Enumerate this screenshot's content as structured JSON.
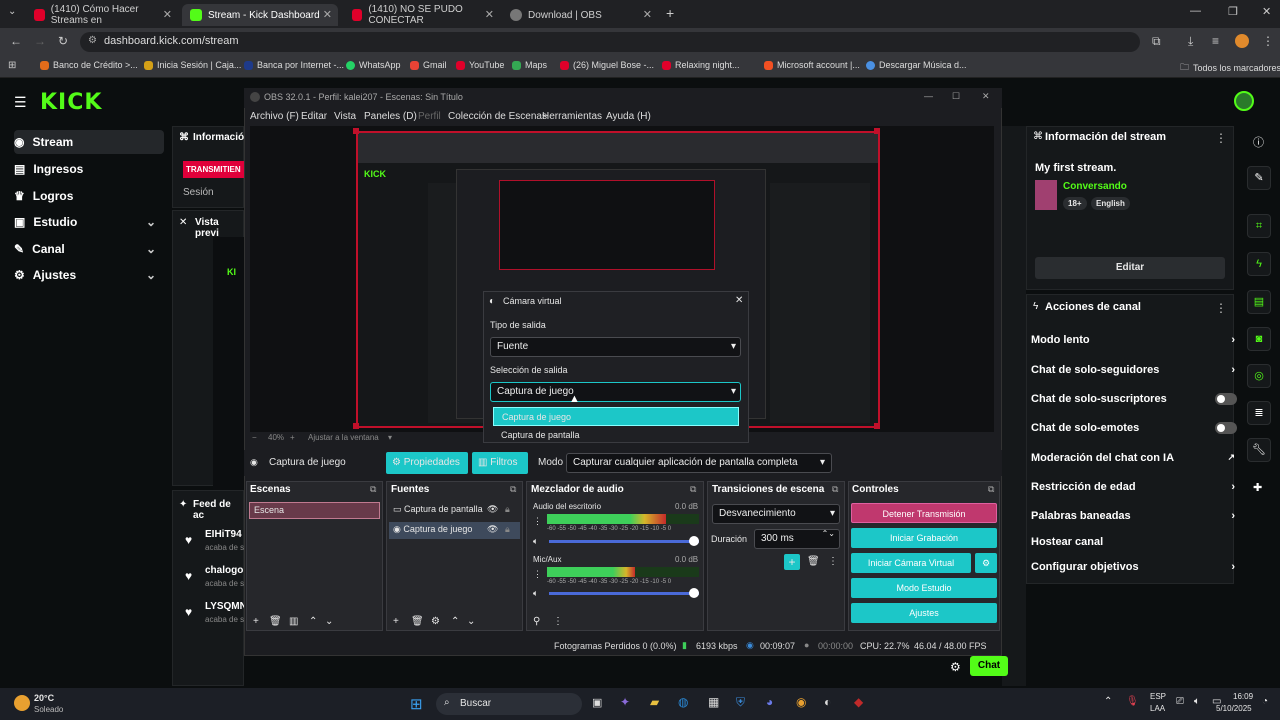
{
  "browser": {
    "tabs": [
      {
        "title": "(1410) Cómo Hacer Streams en",
        "color": "#e0002a"
      },
      {
        "title": "Stream - Kick Dashboard",
        "color": "#53fc18"
      },
      {
        "title": "(1410) NO SE PUDO CONECTAR",
        "color": "#e0002a"
      },
      {
        "title": "Download | OBS",
        "color": "#888888"
      }
    ],
    "url": "dashboard.kick.com/stream",
    "bookmarks": [
      "Banco de Crédito >...",
      "Inicia Sesión | Caja...",
      "Banca por Internet -...",
      "WhatsApp",
      "Gmail",
      "YouTube",
      "Maps",
      "(26) Miguel Bose -...",
      "Relaxing night...",
      "Microsoft account |...",
      "Descargar Música d..."
    ],
    "bookmarks_all": "Todos los marcadores"
  },
  "kick": {
    "logo": "KICK",
    "nav": [
      {
        "label": "Stream",
        "icon": "stream-icon",
        "chev": false
      },
      {
        "label": "Ingresos",
        "icon": "money-icon",
        "chev": false
      },
      {
        "label": "Logros",
        "icon": "trophy-icon",
        "chev": false
      },
      {
        "label": "Estudio",
        "icon": "studio-icon",
        "chev": true
      },
      {
        "label": "Canal",
        "icon": "channel-icon",
        "chev": true
      },
      {
        "label": "Ajustes",
        "icon": "gear-icon",
        "chev": true
      }
    ],
    "info_header": "Informació",
    "live_badge": "TRANSMITIEN",
    "session": "Sesión",
    "preview_header": "Vista previ",
    "feed_header": "Feed de ac",
    "feed": [
      {
        "name": "EIHiT94",
        "sub": "acaba de s"
      },
      {
        "name": "chalogor",
        "sub": "acaba de s"
      },
      {
        "name": "LYSQMN",
        "sub": "acaba de s"
      }
    ],
    "stream_info": {
      "header": "Información del stream",
      "title": "My first stream.",
      "category": "Conversando",
      "tags": [
        "18+",
        "English"
      ],
      "edit": "Editar"
    },
    "channel_actions": {
      "header": "Acciones de canal",
      "rows": [
        {
          "label": "Modo lento",
          "type": "arrow"
        },
        {
          "label": "Chat de solo-seguidores",
          "type": "arrow"
        },
        {
          "label": "Chat de solo-suscriptores",
          "type": "toggle"
        },
        {
          "label": "Chat de solo-emotes",
          "type": "toggle"
        },
        {
          "label": "Moderación del chat con IA",
          "type": "ext"
        },
        {
          "label": "Restricción de edad",
          "type": "arrow"
        },
        {
          "label": "Palabras baneadas",
          "type": "arrow"
        },
        {
          "label": "Hostear canal",
          "type": "none"
        },
        {
          "label": "Configurar objetivos",
          "type": "arrow"
        }
      ]
    },
    "chat_button": "Chat"
  },
  "obs": {
    "title": "OBS 32.0.1 - Perfil: kalei207 - Escenas: Sin Título",
    "menu": [
      "Archivo (F)",
      "Editar",
      "Vista",
      "Paneles (D)",
      "Perfil",
      "Colección de Escenas",
      "Herramientas",
      "Ayuda (H)"
    ],
    "zoom": "40%",
    "fit": "Ajustar a la ventana",
    "source_bar": {
      "name": "Captura de juego",
      "props": "Propiedades",
      "filters": "Filtros",
      "mode_label": "Modo",
      "mode_value": "Capturar cualquier aplicación de pantalla completa"
    },
    "panels": {
      "scenes": "Escenas",
      "sources": "Fuentes",
      "mixer": "Mezclador de audio",
      "transitions": "Transiciones de escena",
      "controls": "Controles"
    },
    "scene_item": "Escena",
    "source_items": [
      "Captura de pantalla",
      "Captura de juego"
    ],
    "mixer": [
      {
        "name": "Audio del escritorio",
        "db": "0.0 dB",
        "level": 0.78
      },
      {
        "name": "Mic/Aux",
        "db": "0.0 dB",
        "level": 0.58
      }
    ],
    "meter_ticks": "-60 -55 -50 -45 -40 -35 -30 -25 -20 -15 -10 -5 0",
    "transition": {
      "type": "Desvanecimiento",
      "duration_label": "Duración",
      "duration": "300 ms"
    },
    "controls": [
      "Detener Transmisión",
      "Iniciar Grabación",
      "Iniciar Cámara Virtual",
      "Modo Estudio",
      "Ajustes"
    ],
    "status": {
      "dropped": "Fotogramas Perdidos 0 (0.0%)",
      "bitrate": "6193 kbps",
      "live_time": "00:09:07",
      "rec_time": "00:00:00",
      "cpu": "CPU: 22.7%",
      "fps": "46.04 / 48.00 FPS"
    },
    "dialog": {
      "title": "Cámara virtual",
      "output_type_label": "Tipo de salida",
      "output_type": "Fuente",
      "output_sel_label": "Selección de salida",
      "output_sel": "Captura de juego",
      "options": [
        "Captura de juego",
        "Captura de pantalla"
      ]
    }
  },
  "taskbar": {
    "weather_temp": "20°C",
    "weather_desc": "Soleado",
    "search": "Buscar",
    "lang1": "ESP",
    "lang2": "LAA",
    "time": "16:09",
    "date": "5/10/2025"
  }
}
